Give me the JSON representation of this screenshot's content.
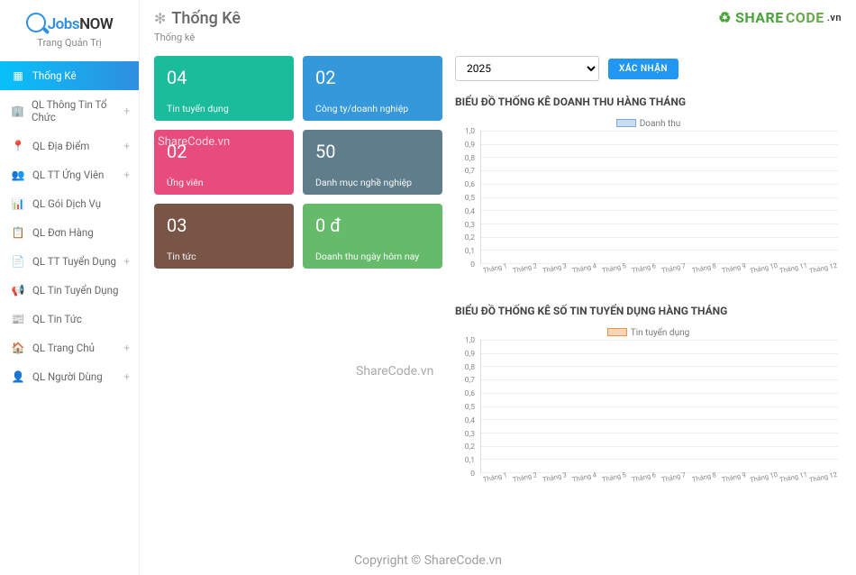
{
  "brand": {
    "blue": "Jobs",
    "dark": "NOW",
    "subtitle": "Trang Quản Trị"
  },
  "page": {
    "title": "Thống Kê",
    "breadcrumb": "Thống kê"
  },
  "watermark": {
    "share": "SHARE",
    "code": "CODE",
    "vn": ".vn"
  },
  "sidebar": [
    {
      "icon": "▦",
      "label": "Thống Kê",
      "expandable": false,
      "active": true
    },
    {
      "icon": "🏢",
      "label": "QL Thông Tin Tổ Chức",
      "expandable": true
    },
    {
      "icon": "📍",
      "label": "QL Địa Điểm",
      "expandable": true
    },
    {
      "icon": "👥",
      "label": "QL TT Ứng Viên",
      "expandable": true
    },
    {
      "icon": "📊",
      "label": "QL Gói Dịch Vụ",
      "expandable": false
    },
    {
      "icon": "📋",
      "label": "QL Đơn Hàng",
      "expandable": false
    },
    {
      "icon": "📄",
      "label": "QL TT Tuyển Dụng",
      "expandable": true
    },
    {
      "icon": "📢",
      "label": "QL Tin Tuyển Dụng",
      "expandable": false
    },
    {
      "icon": "📰",
      "label": "QL Tin Tức",
      "expandable": false
    },
    {
      "icon": "🏠",
      "label": "QL Trang Chủ",
      "expandable": true
    },
    {
      "icon": "👤",
      "label": "QL Người Dùng",
      "expandable": true
    }
  ],
  "cards": [
    {
      "value": "04",
      "label": "Tin tuyển dụng",
      "cls": "teal"
    },
    {
      "value": "02",
      "label": "Công ty/doanh nghiệp",
      "cls": "blue"
    },
    {
      "value": "02",
      "label": "Ứng viên",
      "cls": "pink",
      "overlay": "ShareCode.vn"
    },
    {
      "value": "50",
      "label": "Danh mục nghề nghiệp",
      "cls": "slate"
    },
    {
      "value": "03",
      "label": "Tin tức",
      "cls": "brown"
    },
    {
      "value": "0 đ",
      "label": "Doanh thu ngày hôm nay",
      "cls": "green"
    }
  ],
  "filter": {
    "year": "2025",
    "button": "XÁC NHẬN"
  },
  "chart_data": [
    {
      "type": "bar",
      "title": "BIỂU ĐỒ THỐNG KÊ DOANH THU HÀNG THÁNG",
      "legend": "Doanh thu",
      "categories": [
        "Tháng 1",
        "Tháng 2",
        "Tháng 3",
        "Tháng 4",
        "Tháng 5",
        "Tháng 6",
        "Tháng 7",
        "Tháng 8",
        "Tháng 9",
        "Tháng 10",
        "Tháng 11",
        "Tháng 12"
      ],
      "values": [
        0,
        0,
        0,
        0,
        0,
        0,
        0,
        0,
        0,
        0,
        0,
        0
      ],
      "yticks": [
        "1,0",
        "0,9",
        "0,8",
        "0,7",
        "0,6",
        "0,5",
        "0,4",
        "0,3",
        "0,2",
        "0,1",
        "0"
      ],
      "ylim": [
        0,
        1
      ]
    },
    {
      "type": "bar",
      "title": "BIỂU ĐỒ THỐNG KÊ SỐ TIN TUYỂN DỤNG HÀNG THÁNG",
      "legend": "Tin tuyển dụng",
      "categories": [
        "Tháng 1",
        "Tháng 2",
        "Tháng 3",
        "Tháng 4",
        "Tháng 5",
        "Tháng 6",
        "Tháng 7",
        "Tháng 8",
        "Tháng 9",
        "Tháng 10",
        "Tháng 11",
        "Tháng 12"
      ],
      "values": [
        0,
        0,
        0,
        0,
        0,
        0,
        0,
        0,
        0,
        0,
        0,
        0
      ],
      "yticks": [
        "1,0",
        "0,9",
        "0,8",
        "0,7",
        "0,6",
        "0,5",
        "0,4",
        "0,3",
        "0,2",
        "0,1",
        "0"
      ],
      "ylim": [
        0,
        1
      ]
    }
  ],
  "overlays": {
    "center": "ShareCode.vn",
    "copyright": "Copyright © ShareCode.vn"
  }
}
